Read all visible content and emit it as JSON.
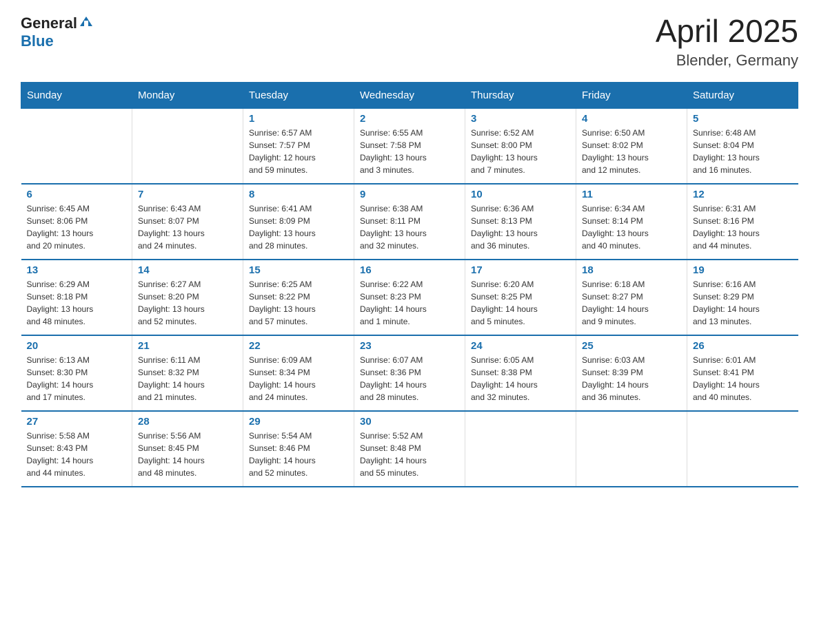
{
  "header": {
    "logo_general": "General",
    "logo_blue": "Blue",
    "title": "April 2025",
    "subtitle": "Blender, Germany"
  },
  "days_of_week": [
    "Sunday",
    "Monday",
    "Tuesday",
    "Wednesday",
    "Thursday",
    "Friday",
    "Saturday"
  ],
  "weeks": [
    [
      {
        "day": "",
        "info": ""
      },
      {
        "day": "",
        "info": ""
      },
      {
        "day": "1",
        "info": "Sunrise: 6:57 AM\nSunset: 7:57 PM\nDaylight: 12 hours\nand 59 minutes."
      },
      {
        "day": "2",
        "info": "Sunrise: 6:55 AM\nSunset: 7:58 PM\nDaylight: 13 hours\nand 3 minutes."
      },
      {
        "day": "3",
        "info": "Sunrise: 6:52 AM\nSunset: 8:00 PM\nDaylight: 13 hours\nand 7 minutes."
      },
      {
        "day": "4",
        "info": "Sunrise: 6:50 AM\nSunset: 8:02 PM\nDaylight: 13 hours\nand 12 minutes."
      },
      {
        "day": "5",
        "info": "Sunrise: 6:48 AM\nSunset: 8:04 PM\nDaylight: 13 hours\nand 16 minutes."
      }
    ],
    [
      {
        "day": "6",
        "info": "Sunrise: 6:45 AM\nSunset: 8:06 PM\nDaylight: 13 hours\nand 20 minutes."
      },
      {
        "day": "7",
        "info": "Sunrise: 6:43 AM\nSunset: 8:07 PM\nDaylight: 13 hours\nand 24 minutes."
      },
      {
        "day": "8",
        "info": "Sunrise: 6:41 AM\nSunset: 8:09 PM\nDaylight: 13 hours\nand 28 minutes."
      },
      {
        "day": "9",
        "info": "Sunrise: 6:38 AM\nSunset: 8:11 PM\nDaylight: 13 hours\nand 32 minutes."
      },
      {
        "day": "10",
        "info": "Sunrise: 6:36 AM\nSunset: 8:13 PM\nDaylight: 13 hours\nand 36 minutes."
      },
      {
        "day": "11",
        "info": "Sunrise: 6:34 AM\nSunset: 8:14 PM\nDaylight: 13 hours\nand 40 minutes."
      },
      {
        "day": "12",
        "info": "Sunrise: 6:31 AM\nSunset: 8:16 PM\nDaylight: 13 hours\nand 44 minutes."
      }
    ],
    [
      {
        "day": "13",
        "info": "Sunrise: 6:29 AM\nSunset: 8:18 PM\nDaylight: 13 hours\nand 48 minutes."
      },
      {
        "day": "14",
        "info": "Sunrise: 6:27 AM\nSunset: 8:20 PM\nDaylight: 13 hours\nand 52 minutes."
      },
      {
        "day": "15",
        "info": "Sunrise: 6:25 AM\nSunset: 8:22 PM\nDaylight: 13 hours\nand 57 minutes."
      },
      {
        "day": "16",
        "info": "Sunrise: 6:22 AM\nSunset: 8:23 PM\nDaylight: 14 hours\nand 1 minute."
      },
      {
        "day": "17",
        "info": "Sunrise: 6:20 AM\nSunset: 8:25 PM\nDaylight: 14 hours\nand 5 minutes."
      },
      {
        "day": "18",
        "info": "Sunrise: 6:18 AM\nSunset: 8:27 PM\nDaylight: 14 hours\nand 9 minutes."
      },
      {
        "day": "19",
        "info": "Sunrise: 6:16 AM\nSunset: 8:29 PM\nDaylight: 14 hours\nand 13 minutes."
      }
    ],
    [
      {
        "day": "20",
        "info": "Sunrise: 6:13 AM\nSunset: 8:30 PM\nDaylight: 14 hours\nand 17 minutes."
      },
      {
        "day": "21",
        "info": "Sunrise: 6:11 AM\nSunset: 8:32 PM\nDaylight: 14 hours\nand 21 minutes."
      },
      {
        "day": "22",
        "info": "Sunrise: 6:09 AM\nSunset: 8:34 PM\nDaylight: 14 hours\nand 24 minutes."
      },
      {
        "day": "23",
        "info": "Sunrise: 6:07 AM\nSunset: 8:36 PM\nDaylight: 14 hours\nand 28 minutes."
      },
      {
        "day": "24",
        "info": "Sunrise: 6:05 AM\nSunset: 8:38 PM\nDaylight: 14 hours\nand 32 minutes."
      },
      {
        "day": "25",
        "info": "Sunrise: 6:03 AM\nSunset: 8:39 PM\nDaylight: 14 hours\nand 36 minutes."
      },
      {
        "day": "26",
        "info": "Sunrise: 6:01 AM\nSunset: 8:41 PM\nDaylight: 14 hours\nand 40 minutes."
      }
    ],
    [
      {
        "day": "27",
        "info": "Sunrise: 5:58 AM\nSunset: 8:43 PM\nDaylight: 14 hours\nand 44 minutes."
      },
      {
        "day": "28",
        "info": "Sunrise: 5:56 AM\nSunset: 8:45 PM\nDaylight: 14 hours\nand 48 minutes."
      },
      {
        "day": "29",
        "info": "Sunrise: 5:54 AM\nSunset: 8:46 PM\nDaylight: 14 hours\nand 52 minutes."
      },
      {
        "day": "30",
        "info": "Sunrise: 5:52 AM\nSunset: 8:48 PM\nDaylight: 14 hours\nand 55 minutes."
      },
      {
        "day": "",
        "info": ""
      },
      {
        "day": "",
        "info": ""
      },
      {
        "day": "",
        "info": ""
      }
    ]
  ]
}
